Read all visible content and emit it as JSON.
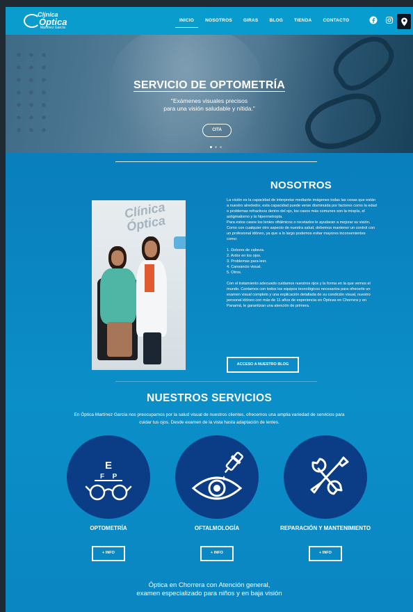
{
  "brand": {
    "logo_line1": "Clínica",
    "logo_line2": "Óptica",
    "logo_line3": "Martínez García"
  },
  "nav": {
    "items": [
      {
        "label": "INICIO",
        "active": true
      },
      {
        "label": "NOSOTROS",
        "active": false
      },
      {
        "label": "GIRAS",
        "active": false
      },
      {
        "label": "BLOG",
        "active": false
      },
      {
        "label": "TIENDA",
        "active": false
      },
      {
        "label": "CONTACTO",
        "active": false
      }
    ],
    "social_icons": [
      "facebook-icon",
      "instagram-icon",
      "location-pin-icon"
    ]
  },
  "hero": {
    "title": "SERVICIO DE OPTOMETRÍA",
    "subtitle_line1": "\"Exámenes visuales precisos",
    "subtitle_line2": "para una visión saludable y nítida.\"",
    "button_label": "CITA",
    "slide_count": 3,
    "active_slide": 1
  },
  "nosotros": {
    "title": "NOSOTROS",
    "paragraph1": "La visión es la capacidad de interpretar mediante imágenes todas las cosas que están a nuestro alrededor, esta capacidad puede verse disminuida por factores como la edad o problemas refractivos dentro del ojo, los casos más comunes son la miopía, el astigmatismo y la hipermetropía.",
    "paragraph2": "Para estos casos los lentes oftálmicos o recetados le ayudaran a mejorar su visión. Como con cualquier otro aspecto de nuestra salud, debemos mantener un control con un profesional idóneo, ya que a lo largo podemos evitar mayores inconvenientes como:",
    "list": [
      "1. Dolores de cabeza.",
      "2. Ardor en los ojos.",
      "3. Problemas para leer.",
      "4. Cansancio visual.",
      "5. Otros."
    ],
    "paragraph3": "Con el tratamiento adecuado cuidamos nuestros ojos y la forma en la que vemos el mundo. Contamos con todos los equipos tecnológicos necesarios para ofrecerle un examen visual completo y una explicación detallada de su condición visual, nuestro personal idóneo con más de 11 años de experiencia en Ópticas en Chorrera y en Panamá, le garantizan una atención de primera.",
    "button_label": "ACCESO A NUESTRO BLOG",
    "photo_sign_line1": "Clínica",
    "photo_sign_line2": "Óptica"
  },
  "servicios": {
    "title": "NUESTROS SERVICIOS",
    "description": "En Óptica Martínez García nos preocupamos por la salud visual de nuestros clientes, ofrecemos una amplia variedad de servicios para cuidar tus ojos. Desde examen de la vista hasta adaptación de lentes.",
    "items": [
      {
        "label": "OPTOMETRÍA",
        "icon": "eye-chart-glasses-icon",
        "button_label": "+ INFO"
      },
      {
        "label": "OFTALMOLOGÍA",
        "icon": "eye-dropper-icon",
        "button_label": "+ INFO"
      },
      {
        "label": "REPARACIÓN Y MANTENIMIENTO",
        "icon": "wrench-screwdriver-icon",
        "button_label": "+ INFO"
      }
    ],
    "eye_chart_letters": [
      "E",
      "F",
      "P"
    ]
  },
  "footer": {
    "line1": "Óptica en Chorrera con Atención general,",
    "line2": "examen especializado para niños y en baja visión"
  },
  "colors": {
    "header": "#079ccf",
    "background": "#0a82bf",
    "service_circle": "#0b3d86",
    "text": "#ffffff"
  }
}
